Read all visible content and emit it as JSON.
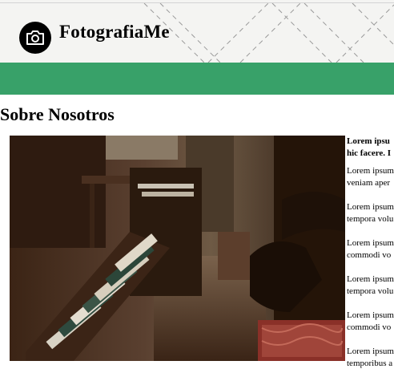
{
  "header": {
    "brand": "FotografiaMe",
    "logo_icon": "camera-icon"
  },
  "colors": {
    "navbar": "#38a169",
    "header_bg": "#f4f4f2"
  },
  "main": {
    "title": "Sobre Nosotros",
    "image_icon": "library-photo",
    "paragraphs": [
      {
        "line1": "Lorem ipsu",
        "line2": "hic facere. I"
      },
      {
        "line1": "Lorem ipsum",
        "line2": "veniam aper"
      },
      {
        "line1": "Lorem ipsum",
        "line2": "tempora volu"
      },
      {
        "line1": "Lorem ipsum",
        "line2": "commodi vo"
      },
      {
        "line1": "Lorem ipsum",
        "line2": "tempora volu"
      },
      {
        "line1": "Lorem ipsum",
        "line2": "commodi vo"
      },
      {
        "line1": "Lorem ipsum",
        "line2": "temporibus a"
      }
    ]
  }
}
